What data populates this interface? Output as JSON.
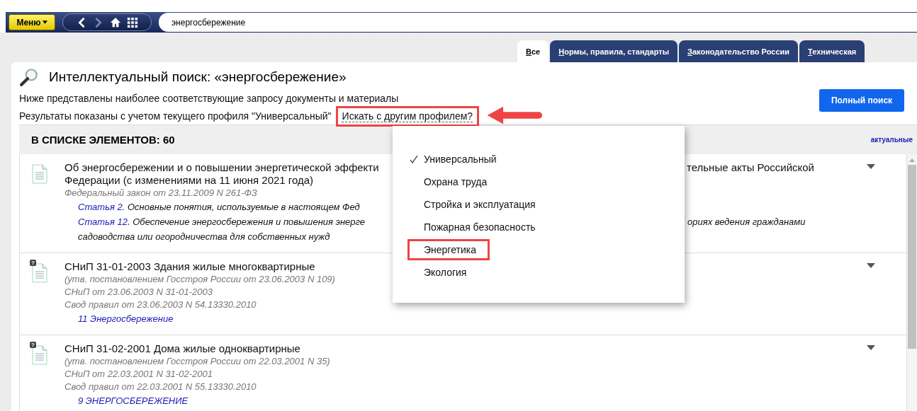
{
  "toolbar": {
    "menu_button": "Меню",
    "search_value": "энергосбережение"
  },
  "tabs": [
    {
      "label": "Все",
      "selected": true
    },
    {
      "label": "Нормы, правила, стандарты",
      "selected": false
    },
    {
      "label": "Законодательство России",
      "selected": false
    },
    {
      "label": "Техническая",
      "selected": false
    }
  ],
  "heading": "Интеллектуальный поиск: «энергосбережение»",
  "description": "Ниже представлены наиболее соответствующие запросу документы и материалы",
  "profile_note": "Результаты показаны с учетом текущего профиля \"Универсальный\"",
  "profile_link": {
    "label": "Искать с другим профилем?",
    "annotated": true
  },
  "full_search_button": "Полный поиск",
  "list_header": {
    "title": "В СПИСКЕ ЭЛЕМЕНТОВ: 60",
    "filter": "актуальные"
  },
  "documents": [
    {
      "lines": [
        {
          "kind": "title",
          "text": "Об энергосбережении и о повышении энергетической эффекти",
          "right": "тельные акты Российской"
        },
        {
          "kind": "title",
          "text": "Федерации (с изменениями на 11 июня 2021 года)"
        },
        {
          "kind": "meta",
          "text": "Федеральный закон от 23.11.2009 N 261-ФЗ"
        },
        {
          "kind": "ref",
          "link": "Статья 2.",
          "text": "Основные понятия, используемые в настоящем Фед"
        },
        {
          "kind": "ref",
          "link": "Статья 12.",
          "text": "Обеспечение энергосбережения и повышения энерге",
          "right": "ориях ведения гражданами"
        },
        {
          "kind": "ref",
          "text": "садоводства или огородничества для собственных нужд"
        }
      ]
    },
    {
      "badge": "?",
      "lines": [
        {
          "kind": "title",
          "text": "СНиП 31-01-2003 Здания жилые многоквартирные"
        },
        {
          "kind": "meta",
          "text": "(утв. постановлением Госстроя России от 23.06.2003 N 109)"
        },
        {
          "kind": "meta",
          "text": "СНиП от 23.06.2003 N 31-01-2003"
        },
        {
          "kind": "meta",
          "text": "Свод правил от 23.06.2003 N 54.13330.2010"
        },
        {
          "kind": "ref",
          "link": "11 Энергосбережение"
        }
      ]
    },
    {
      "badge": "?",
      "lines": [
        {
          "kind": "title",
          "text": "СНиП 31-02-2001 Дома жилые одноквартирные"
        },
        {
          "kind": "meta",
          "text": "(утв. постановлением Госстроя России от 22.03.2001 N 35)"
        },
        {
          "kind": "meta",
          "text": "СНиП от 22.03.2001 N 31-02-2001"
        },
        {
          "kind": "meta",
          "text": "Свод правил от 22.03.2001 N 55.13330.2010"
        },
        {
          "kind": "ref",
          "link": "9 ЭНЕРГОСБЕРЕЖЕНИЕ"
        }
      ]
    }
  ],
  "profile_menu": [
    {
      "label": "Универсальный",
      "selected": true,
      "annotated": false
    },
    {
      "label": "Охрана труда",
      "selected": false,
      "annotated": false
    },
    {
      "label": "Стройка и эксплуатация",
      "selected": false,
      "annotated": false
    },
    {
      "label": "Пожарная безопасность",
      "selected": false,
      "annotated": false
    },
    {
      "label": "Энергетика",
      "selected": false,
      "annotated": true
    },
    {
      "label": "Экология",
      "selected": false,
      "annotated": false
    }
  ]
}
